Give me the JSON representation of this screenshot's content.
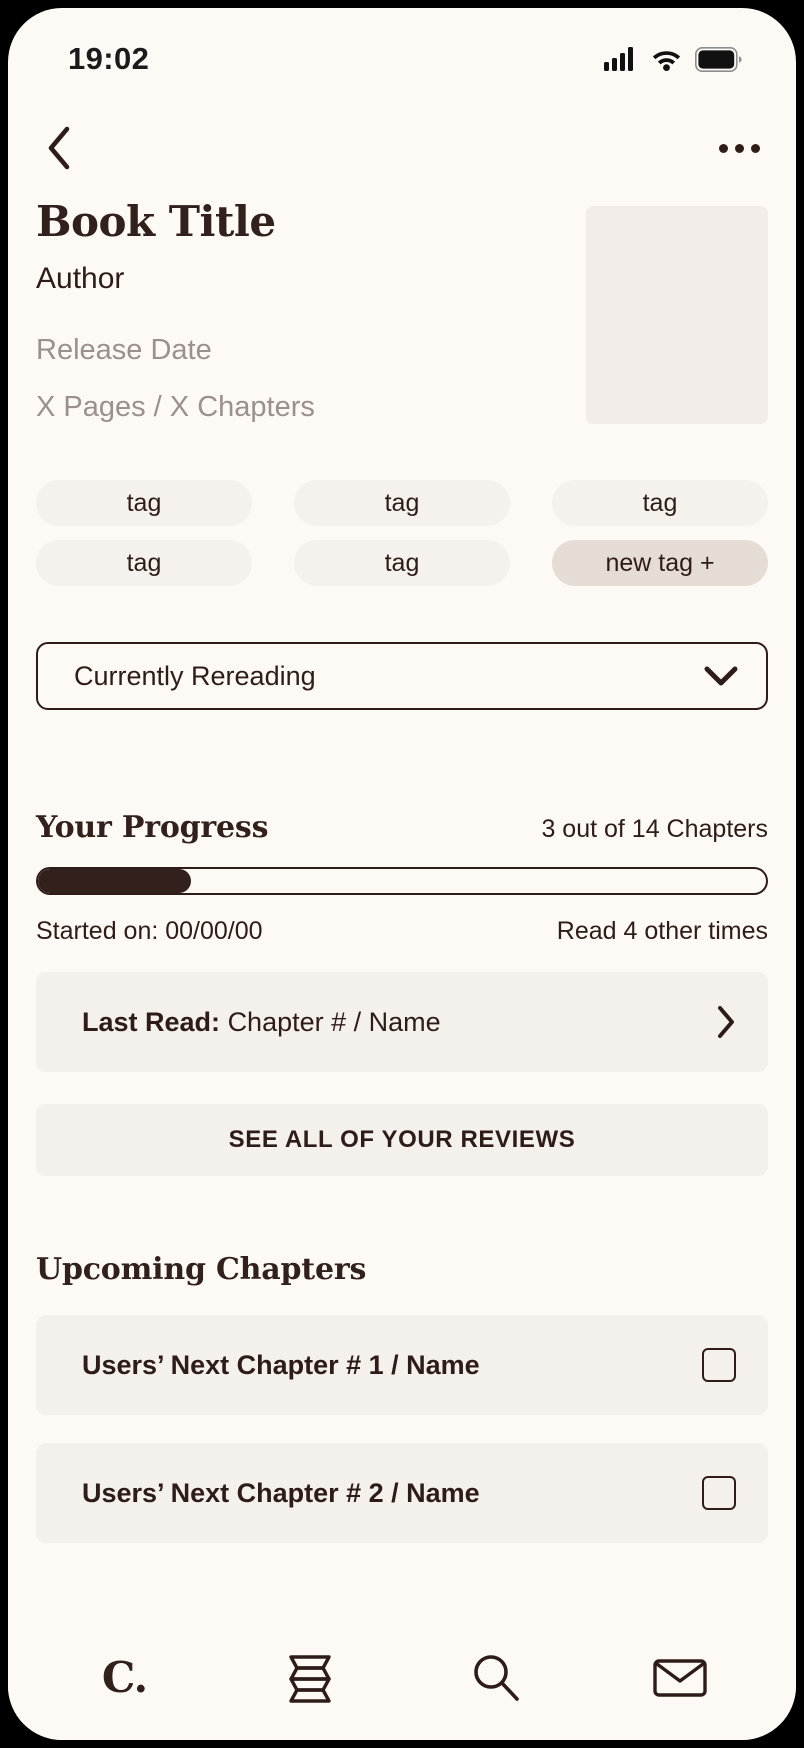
{
  "status_bar": {
    "time": "19:02",
    "icons": [
      "cellular-signal-icon",
      "wifi-icon",
      "battery-icon"
    ]
  },
  "top_nav": {
    "back_icon": "chevron-left-icon",
    "more_icon": "more-options-icon"
  },
  "book": {
    "title": "Book Title",
    "author": "Author",
    "release_date": "Release Date",
    "pages_chapters": "X Pages / X Chapters",
    "cover_placeholder": "book-cover-placeholder"
  },
  "tags": [
    {
      "label": "tag",
      "is_new": false
    },
    {
      "label": "tag",
      "is_new": false
    },
    {
      "label": "tag",
      "is_new": false
    },
    {
      "label": "tag",
      "is_new": false
    },
    {
      "label": "tag",
      "is_new": false
    },
    {
      "label": "new tag +",
      "is_new": true
    }
  ],
  "reading_status": {
    "selected": "Currently Rereading",
    "chevron_icon": "chevron-down-icon"
  },
  "progress": {
    "title": "Your Progress",
    "count_label": "3 out of 14 Chapters",
    "chapters_read": 3,
    "chapters_total": 14,
    "percent": 21,
    "started_on": "Started on: 00/00/00",
    "reread_count": "Read 4 other times"
  },
  "last_read": {
    "prefix": "Last Read:",
    "value": "Chapter # / Name",
    "chevron_icon": "chevron-right-icon"
  },
  "reviews_button": {
    "label": "SEE ALL OF YOUR REVIEWS"
  },
  "upcoming": {
    "title": "Upcoming Chapters",
    "items": [
      {
        "label": "Users’ Next Chapter # 1 / Name",
        "checked": false
      },
      {
        "label": "Users’ Next Chapter # 2 / Name",
        "checked": false
      }
    ]
  },
  "bottom_nav": {
    "items": [
      {
        "name": "home-logo",
        "label": "C.",
        "icon": "brand-logo-icon"
      },
      {
        "name": "library",
        "label": "",
        "icon": "books-stack-icon"
      },
      {
        "name": "search",
        "label": "",
        "icon": "search-icon"
      },
      {
        "name": "inbox",
        "label": "",
        "icon": "mail-icon"
      }
    ]
  },
  "colors": {
    "background": "#FDFAF5",
    "text_primary": "#2E1C18",
    "text_muted": "#9A908D",
    "surface": "#F4F0EC",
    "accent_tag": "#E5DCD6"
  }
}
